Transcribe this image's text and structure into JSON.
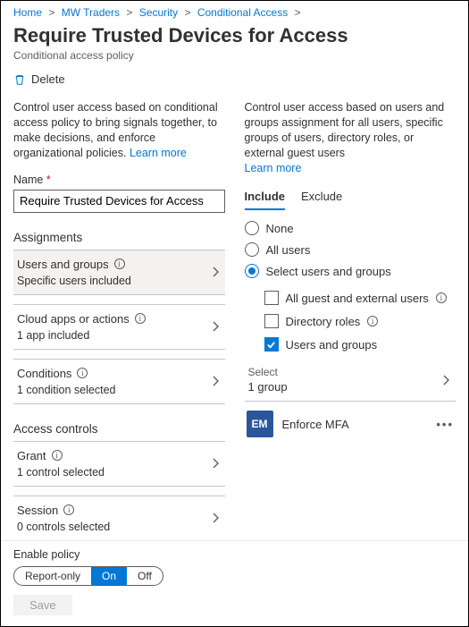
{
  "breadcrumb": {
    "items": [
      "Home",
      "MW Traders",
      "Security",
      "Conditional Access"
    ]
  },
  "title": "Require Trusted Devices for Access",
  "subtitle": "Conditional access policy",
  "toolbar": {
    "delete": "Delete"
  },
  "left": {
    "descr": "Control user access based on conditional access policy to bring signals together, to make decisions, and enforce organizational policies.",
    "learnmore": "Learn more",
    "nameLabel": "Name",
    "nameValue": "Require Trusted Devices for Access",
    "assignmentsHeading": "Assignments",
    "usersGroups": {
      "title": "Users and groups",
      "sub": "Specific users included"
    },
    "cloudApps": {
      "title": "Cloud apps or actions",
      "sub": "1 app included"
    },
    "conditions": {
      "title": "Conditions",
      "sub": "1 condition selected"
    },
    "accessHeading": "Access controls",
    "grant": {
      "title": "Grant",
      "sub": "1 control selected"
    },
    "session": {
      "title": "Session",
      "sub": "0 controls selected"
    }
  },
  "right": {
    "descr": "Control user access based on users and groups assignment for all users, specific groups of users, directory roles, or external guest users",
    "learnmore": "Learn more",
    "tabs": {
      "include": "Include",
      "exclude": "Exclude"
    },
    "radios": {
      "none": "None",
      "all": "All users",
      "select": "Select users and groups"
    },
    "checks": {
      "guest": "All guest and external users",
      "roles": "Directory roles",
      "ug": "Users and groups"
    },
    "selectLabel": "Select",
    "selectValue": "1 group",
    "group": {
      "initials": "EM",
      "name": "Enforce MFA"
    }
  },
  "footer": {
    "enableLabel": "Enable policy",
    "report": "Report-only",
    "on": "On",
    "off": "Off",
    "save": "Save"
  }
}
